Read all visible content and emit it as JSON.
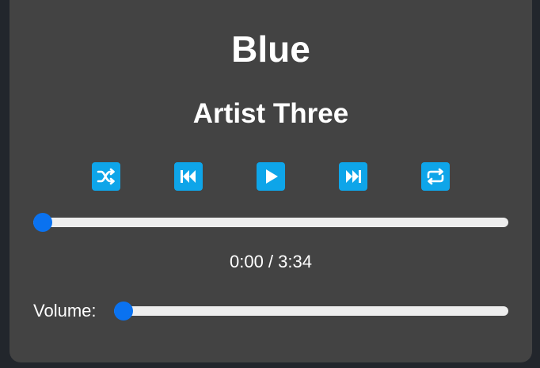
{
  "player": {
    "song_title": "Blue",
    "artist": "Artist Three",
    "controls": {
      "shuffle_icon": "shuffle-icon",
      "previous_icon": "skip-previous-icon",
      "play_icon": "play-icon",
      "next_icon": "skip-next-icon",
      "repeat_icon": "repeat-icon"
    },
    "progress": {
      "current_time": "0:00",
      "duration": "3:34",
      "display": "0:00 / 3:34",
      "fraction": 0
    },
    "volume": {
      "label": "Volume:",
      "fraction": 0
    }
  },
  "colors": {
    "background": "#22262c",
    "card": "#434343",
    "control_button": "#0ea5e9",
    "slider_thumb": "#0a72f0",
    "slider_track": "#eeeeee",
    "text": "#ffffff"
  }
}
